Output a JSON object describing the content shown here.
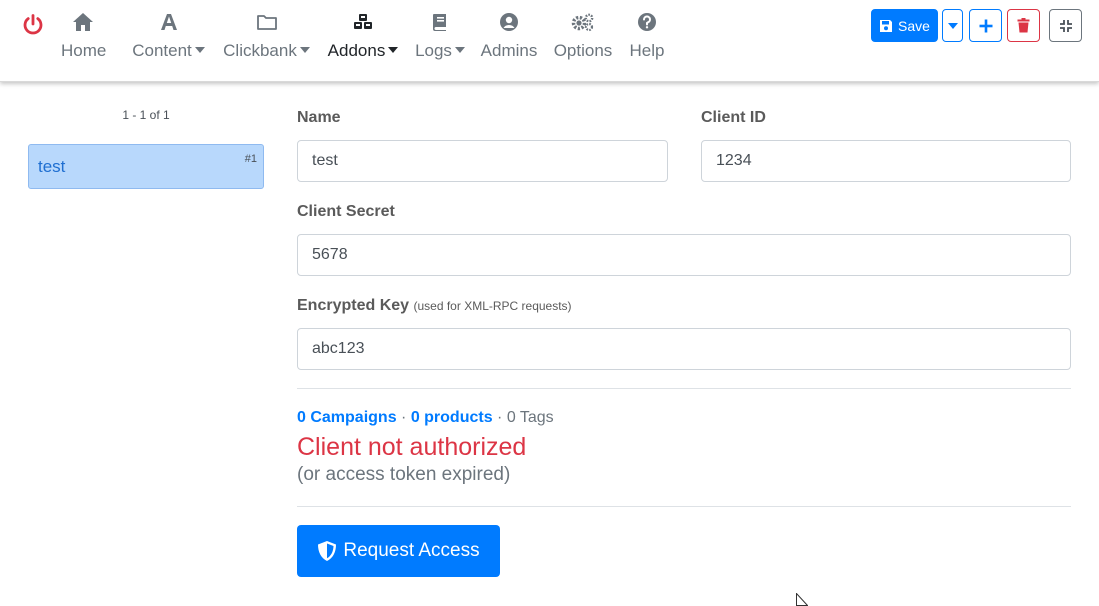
{
  "nav": {
    "items": [
      {
        "label": "Home",
        "icon": "home-icon",
        "dropdown": false
      },
      {
        "label": "Content",
        "icon": "font-icon",
        "dropdown": true
      },
      {
        "label": "Clickbank",
        "icon": "folder-icon",
        "dropdown": true
      },
      {
        "label": "Addons",
        "icon": "cubes-icon",
        "dropdown": true,
        "active": true
      },
      {
        "label": "Logs",
        "icon": "book-icon",
        "dropdown": true
      },
      {
        "label": "Admins",
        "icon": "user-circle-icon",
        "dropdown": false
      },
      {
        "label": "Options",
        "icon": "cogs-icon",
        "dropdown": false
      },
      {
        "label": "Help",
        "icon": "question-circle-icon",
        "dropdown": false
      }
    ]
  },
  "toolbar": {
    "save_label": "Save"
  },
  "sidebar": {
    "pager": "1 - 1 of 1",
    "items": [
      {
        "name": "test",
        "number": "#1",
        "selected": true
      }
    ]
  },
  "form": {
    "name": {
      "label": "Name",
      "value": "test"
    },
    "client_id": {
      "label": "Client ID",
      "value": "1234"
    },
    "client_secret": {
      "label": "Client Secret",
      "value": "5678"
    },
    "encrypted_key": {
      "label": "Encrypted Key",
      "hint": "(used for XML-RPC requests)",
      "value": "abc123"
    }
  },
  "stats": {
    "campaigns": "0 Campaigns",
    "sep1": " · ",
    "products": "0 products",
    "sep2": " · ",
    "tags": "0 Tags"
  },
  "status": {
    "title": "Client not authorized",
    "subtitle": "(or access token expired)"
  },
  "request_button": {
    "label": "Request Access"
  },
  "colors": {
    "primary": "#007bff",
    "danger": "#dc3545",
    "selected_bg": "#b8d8fc"
  }
}
